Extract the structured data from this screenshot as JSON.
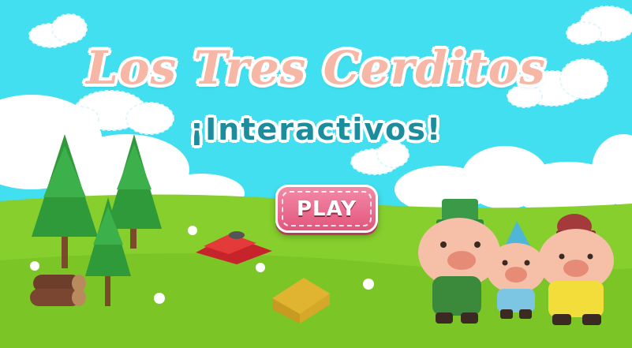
{
  "title": {
    "main": "Los Tres Cerditos",
    "subtitle": "¡Interactivos!"
  },
  "play_button": {
    "label": "PLAY"
  },
  "colors": {
    "sky": "#41dfef",
    "grass": "#7fcc2a",
    "title_pink": "#f7b7a6",
    "subtitle_teal": "#1c8d9d",
    "button_pink": "#e2567c"
  },
  "scene_items": [
    "trees",
    "logs",
    "bricks",
    "straw-bale",
    "flowers",
    "pig-green-hat",
    "pig-blue-hat",
    "pig-red-hat"
  ]
}
